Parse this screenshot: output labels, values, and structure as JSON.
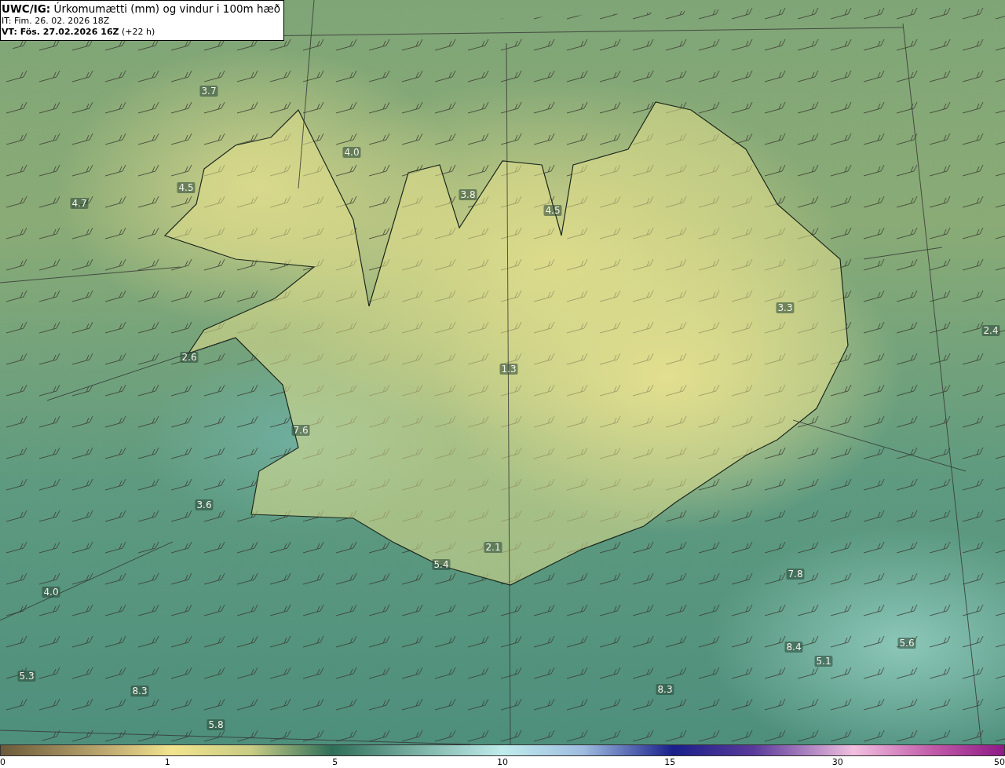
{
  "title_box": {
    "lines": [
      "**UWC/IG:** Úrkomumætti (mm) og vindur i 100m hæð",
      "IT: Fim. 26. 02. 2026 18Z",
      "**VT: Fös. 27.02.2026 16Z** (+22 h)"
    ]
  },
  "map": {
    "value_labels": [
      "3.7",
      "4.0",
      "4.5",
      "4.7",
      "3.8",
      "4.5",
      "2.6",
      "7.6",
      "3.6",
      "5.4",
      "4.0",
      "5.3",
      "8.3",
      "5.8",
      "7.8",
      "5.6",
      "8.4",
      "5.1",
      "8.3",
      "2.4",
      "3.3",
      "1.3",
      "2.1"
    ]
  },
  "colorbar": {
    "ticks": [
      "0",
      "1",
      "5",
      "10",
      "15",
      "30",
      "50"
    ]
  }
}
